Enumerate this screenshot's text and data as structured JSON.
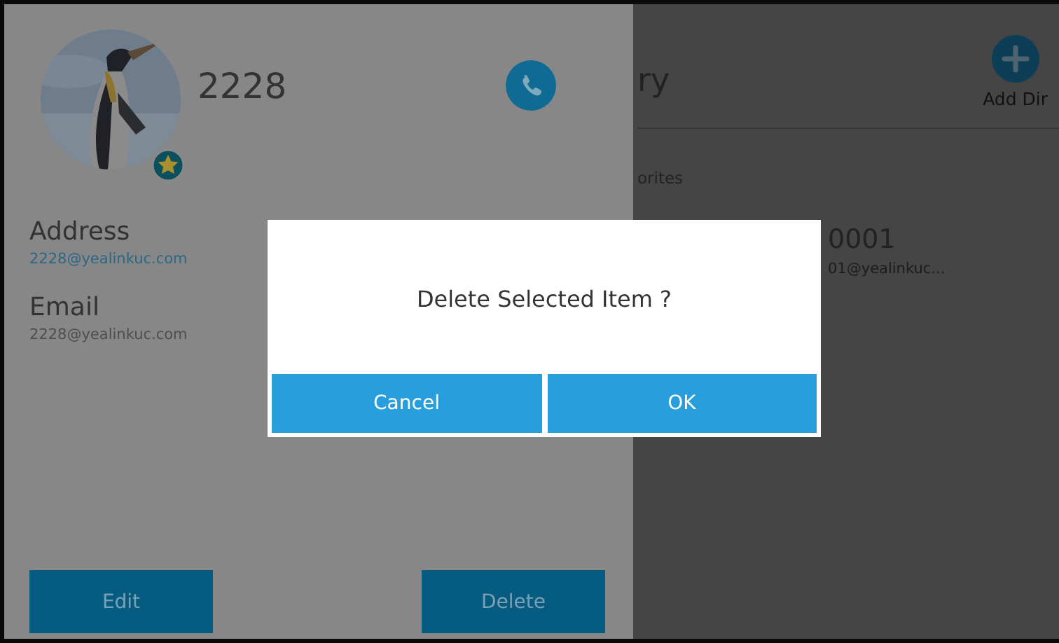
{
  "contact": {
    "name": "2228",
    "favorite": true,
    "fields": [
      {
        "label": "Address",
        "value": "2228@yealinkuc.com",
        "kind": "link"
      },
      {
        "label": "Email",
        "value": "2228@yealinkuc.com",
        "kind": "plain"
      }
    ],
    "buttons": [
      "Edit",
      "Delete"
    ]
  },
  "directory": {
    "title": "ry",
    "add_label": "Add Dir",
    "group": "orites",
    "entries": [
      {
        "name": "0001",
        "address": "01@yealinkuc..."
      }
    ]
  },
  "dialog": {
    "message": "Delete Selected Item ?",
    "buttons": [
      "Cancel",
      "OK"
    ]
  }
}
